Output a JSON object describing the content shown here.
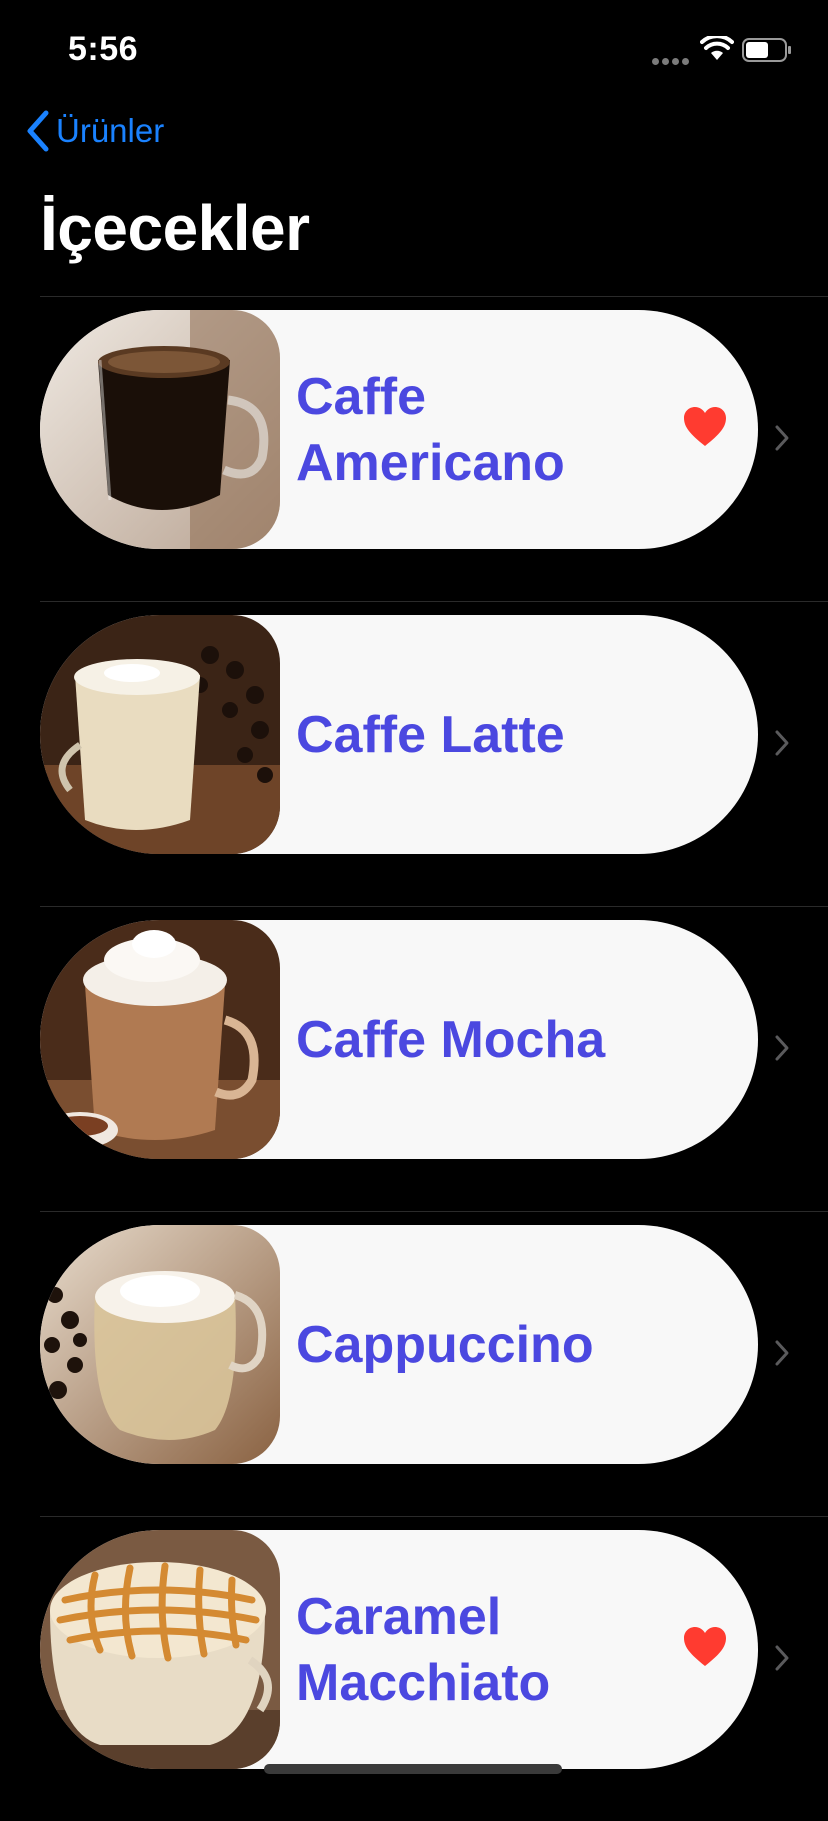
{
  "status": {
    "time": "5:56"
  },
  "nav": {
    "back_label": "Ürünler",
    "title": "İçecekler"
  },
  "items": [
    {
      "name": "Caffe Americano",
      "favorite": true
    },
    {
      "name": "Caffe Latte",
      "favorite": false
    },
    {
      "name": "Caffe Mocha",
      "favorite": false
    },
    {
      "name": "Cappuccino",
      "favorite": false
    },
    {
      "name": "Caramel Macchiato",
      "favorite": true
    }
  ],
  "colors": {
    "accent_blue": "#1a82ff",
    "item_text": "#4b48e0",
    "heart": "#ff3b30",
    "card_bg": "#f8f8f8"
  },
  "icons": {
    "back": "chevron-left-icon",
    "favorite": "heart-icon",
    "disclosure": "chevron-right-icon"
  }
}
